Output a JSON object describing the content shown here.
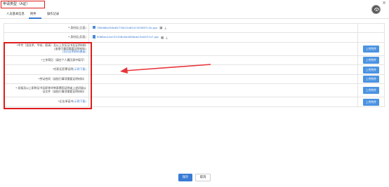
{
  "window": {
    "title": "申请类型（A证）",
    "close_glyph": "×"
  },
  "tabs": [
    {
      "label": "人员基本信息"
    },
    {
      "label": "附件"
    },
    {
      "label": "操作记录"
    }
  ],
  "rows": [
    {
      "label_text": "* 身份证(正面)",
      "file": "76fe66b284b8473fa22a6541505697c2b.jpg",
      "icons": [
        "view-icon",
        "download-icon"
      ]
    },
    {
      "label_text": "* 身份证(反面)",
      "file": "9068eca2a232458c8d469bbb25d0557a7.jpg",
      "icons": [
        "view-icon",
        "download-icon"
      ]
    },
    {
      "label_line1": "*中专（含技术、中技、职高）及以上学历证书及证明材料",
      "label_line2": "(该指引事项需要证明材料)",
      "label_link": "(学历证明材料模板)",
      "button": "上传附件"
    },
    {
      "label_text": "*工作简历（请在个人履历表中填写）",
      "button": "上传附件"
    },
    {
      "label_text": "*任职无犯罪证明",
      "label_link": "(示例下载)",
      "button": "上传附件"
    },
    {
      "label_text": "*劳动合同（该指引事项需要证明材料）",
      "button": "上传附件"
    },
    {
      "label_line1": "* 初级及以上职称证书及职称评审表聘用证明或上述初级以",
      "label_line2": "证文件（该指引事项需要证明材料）",
      "button": "上传附件"
    },
    {
      "label_text": "*企业承诺书",
      "label_link": "(示例下载)",
      "button": "上传附件"
    }
  ],
  "footer": {
    "save_label": "保存",
    "cancel_label": "取消"
  },
  "accent_color": "#3a7bd5",
  "annotation_color": "#e01b1b"
}
